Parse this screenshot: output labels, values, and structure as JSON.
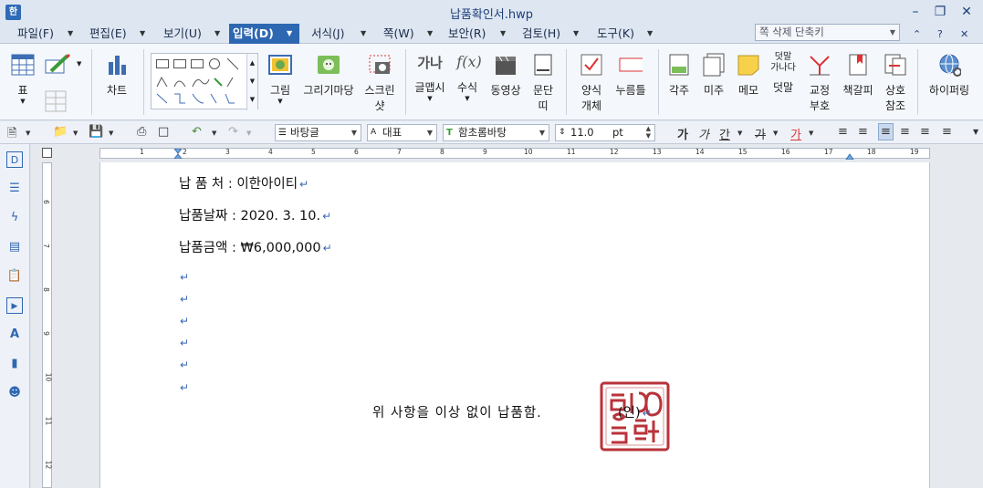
{
  "window": {
    "title": "납품확인서.hwp",
    "app_icon_label": "한"
  },
  "menu": {
    "items": [
      {
        "label": "파일(F)"
      },
      {
        "label": "편집(E)"
      },
      {
        "label": "보기(U)"
      },
      {
        "label": "입력(D)",
        "active": true
      },
      {
        "label": "서식(J)"
      },
      {
        "label": "쪽(W)"
      },
      {
        "label": "보안(R)"
      },
      {
        "label": "검토(H)"
      },
      {
        "label": "도구(K)"
      }
    ],
    "shortcut_search_placeholder": "쪽 삭제 단축키"
  },
  "ribbon": {
    "table": "표",
    "chart": "차트",
    "picture": "그림",
    "drawing_madang": "그리기마당",
    "screenshot_line1": "스크린",
    "screenshot_line2": "샷",
    "glyph": "글맵시",
    "formula": "수식",
    "video": "동영상",
    "divider_line1": "문단",
    "divider_line2": "띠",
    "form_obj_line1": "양식",
    "form_obj_line2": "개체",
    "push_button": "누름틀",
    "footnote": "각주",
    "endnote": "미주",
    "memo": "메모",
    "overlay_icon_line1": "덧말",
    "overlay_icon_line2": "가나다",
    "overlay": "덧말",
    "proofread_line1": "교정",
    "proofread_line2": "부호",
    "bookmark": "책갈피",
    "crossref_line1": "상호",
    "crossref_line2": "참조",
    "hyperlink": "하이퍼링",
    "glyph_icon": "가나",
    "formula_icon": "f(x)"
  },
  "format_bar": {
    "style": "바탕글",
    "font_lang": "대표",
    "font_name": "함초롬바탕",
    "font_size": "11.0",
    "size_unit": "pt",
    "bold_icon": "가",
    "italic_icon": "가",
    "underline_icon": "간",
    "strike_icon": "가",
    "color_icon": "가"
  },
  "ruler": {
    "h_numbers": [
      "1",
      "2",
      "3",
      "4",
      "5",
      "6",
      "7",
      "8",
      "9",
      "10",
      "11",
      "12",
      "13",
      "14",
      "15",
      "16",
      "17",
      "18",
      "19"
    ],
    "v_numbers": [
      "6",
      "7",
      "8",
      "9",
      "10",
      "11",
      "12"
    ]
  },
  "document": {
    "lines": [
      {
        "label": "납 품 처 :",
        "value": "이한아이티"
      },
      {
        "label": "납품날짜 :",
        "value": "2020. 3. 10."
      },
      {
        "label": "납품금액 :",
        "value": "₩6,000,000"
      }
    ],
    "paragraph_mark": "↵",
    "closing": "위 사항을 이상 없이 납품함.",
    "signature": "(인)",
    "seal_text": "인"
  },
  "colors": {
    "accent": "#2e67b1",
    "seal_red": "#b8333a",
    "paragraph_mark": "#3a67b5"
  }
}
